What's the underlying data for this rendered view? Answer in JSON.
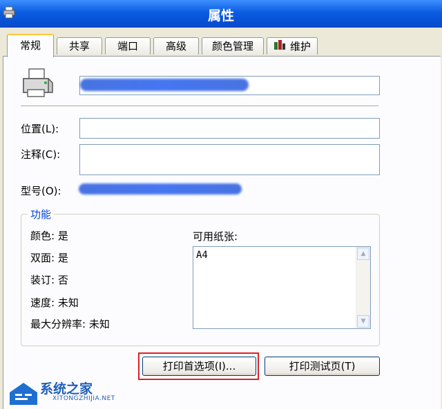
{
  "window": {
    "title": "属性"
  },
  "tabs": [
    {
      "label": "常规",
      "active": true
    },
    {
      "label": "共享"
    },
    {
      "label": "端口"
    },
    {
      "label": "高级"
    },
    {
      "label": "颜色管理"
    },
    {
      "label": "维护"
    }
  ],
  "general": {
    "location_label": "位置(L):",
    "location_value": "",
    "comment_label": "注释(C):",
    "comment_value": "",
    "model_label": "型号(O):"
  },
  "features": {
    "title": "功能",
    "color": "颜色: 是",
    "duplex": "双面: 是",
    "staple": "装订: 否",
    "speed": "速度: 未知",
    "max_resolution": "最大分辨率: 未知",
    "paper_label": "可用纸张:",
    "paper_items": [
      "A4"
    ]
  },
  "buttons": {
    "preferences": "打印首选项(I)...",
    "test_page": "打印测试页(T)"
  },
  "watermark": {
    "brand": "系统之家",
    "url": "XITONGZHIJIA.NET"
  },
  "colors": {
    "titlebar": "#0a5ce0",
    "highlight": "#e02020",
    "group_title": "#0046d5"
  }
}
